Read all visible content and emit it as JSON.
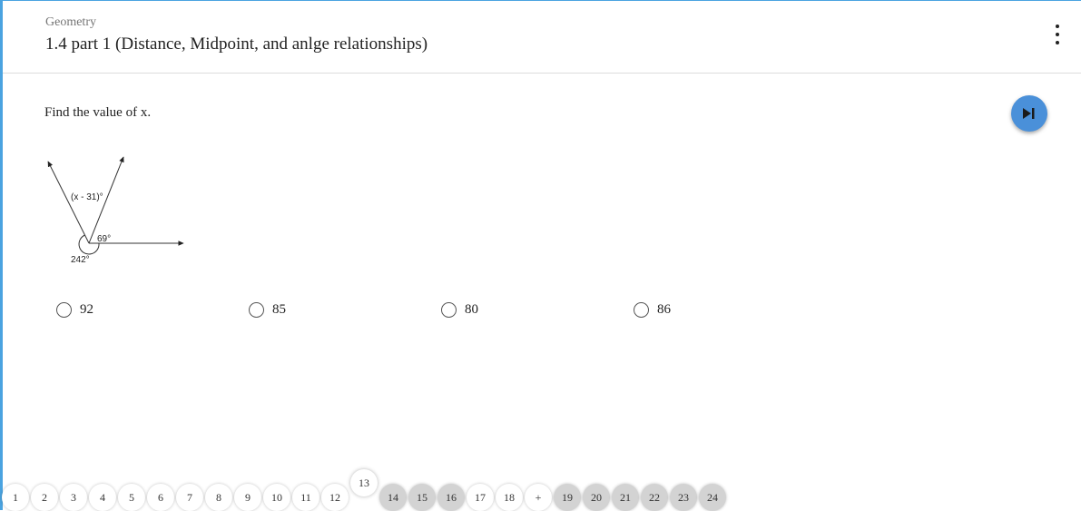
{
  "header": {
    "course": "Geometry",
    "assignment_title": "1.4 part 1 (Distance, Midpoint, and anlge relationships)",
    "menu_icon": "more-vertical-icon"
  },
  "question": {
    "prompt": "Find the value of x.",
    "skip_icon": "skip-next-icon",
    "figure": {
      "angle_top_label": "(x - 31)°",
      "angle_right_label": "69°",
      "angle_reflex_label": "242°"
    },
    "choices": [
      {
        "label": "92"
      },
      {
        "label": "85"
      },
      {
        "label": "80"
      },
      {
        "label": "86"
      }
    ]
  },
  "problem_nav": {
    "items": [
      {
        "label": "1",
        "state": "done"
      },
      {
        "label": "2",
        "state": "done"
      },
      {
        "label": "3",
        "state": "done"
      },
      {
        "label": "4",
        "state": "done"
      },
      {
        "label": "5",
        "state": "done"
      },
      {
        "label": "6",
        "state": "done"
      },
      {
        "label": "7",
        "state": "done"
      },
      {
        "label": "8",
        "state": "done"
      },
      {
        "label": "9",
        "state": "done"
      },
      {
        "label": "10",
        "state": "done"
      },
      {
        "label": "11",
        "state": "done"
      },
      {
        "label": "12",
        "state": "done"
      },
      {
        "label": "13",
        "state": "current"
      },
      {
        "label": "14",
        "state": "todo"
      },
      {
        "label": "15",
        "state": "todo"
      },
      {
        "label": "16",
        "state": "todo"
      },
      {
        "label": "17",
        "state": "done"
      },
      {
        "label": "18",
        "state": "done"
      },
      {
        "label": "+",
        "state": "done"
      },
      {
        "label": "19",
        "state": "todo"
      },
      {
        "label": "20",
        "state": "todo"
      },
      {
        "label": "21",
        "state": "todo"
      },
      {
        "label": "22",
        "state": "todo"
      },
      {
        "label": "23",
        "state": "todo"
      },
      {
        "label": "24",
        "state": "todo"
      }
    ]
  },
  "colors": {
    "accent": "#4a90d9",
    "frame": "#4aa3e0",
    "todo_pill": "#d3d3d3"
  }
}
